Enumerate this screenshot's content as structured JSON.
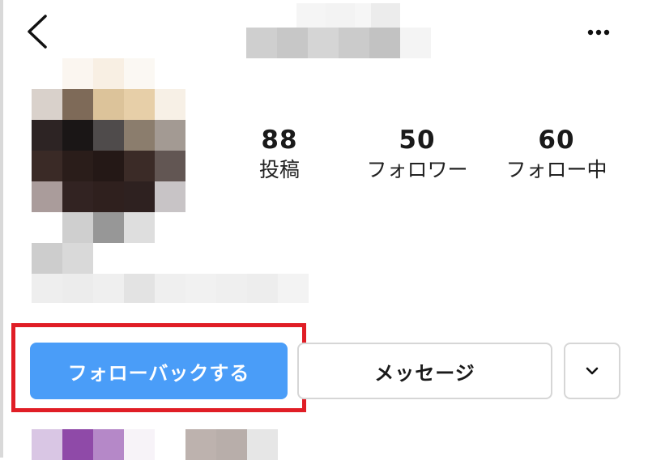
{
  "header": {
    "back_icon": "chevron-left-icon",
    "more_icon": "more-horizontal-icon"
  },
  "stats": [
    {
      "value": "88",
      "label": "投稿"
    },
    {
      "value": "50",
      "label": "フォロワー"
    },
    {
      "value": "60",
      "label": "フォロー中"
    }
  ],
  "actions": {
    "follow_back_label": "フォローバックする",
    "message_label": "メッセージ",
    "suggest_icon": "chevron-down-icon"
  },
  "colors": {
    "accent": "#4a9df8",
    "highlight": "#e01e26"
  }
}
